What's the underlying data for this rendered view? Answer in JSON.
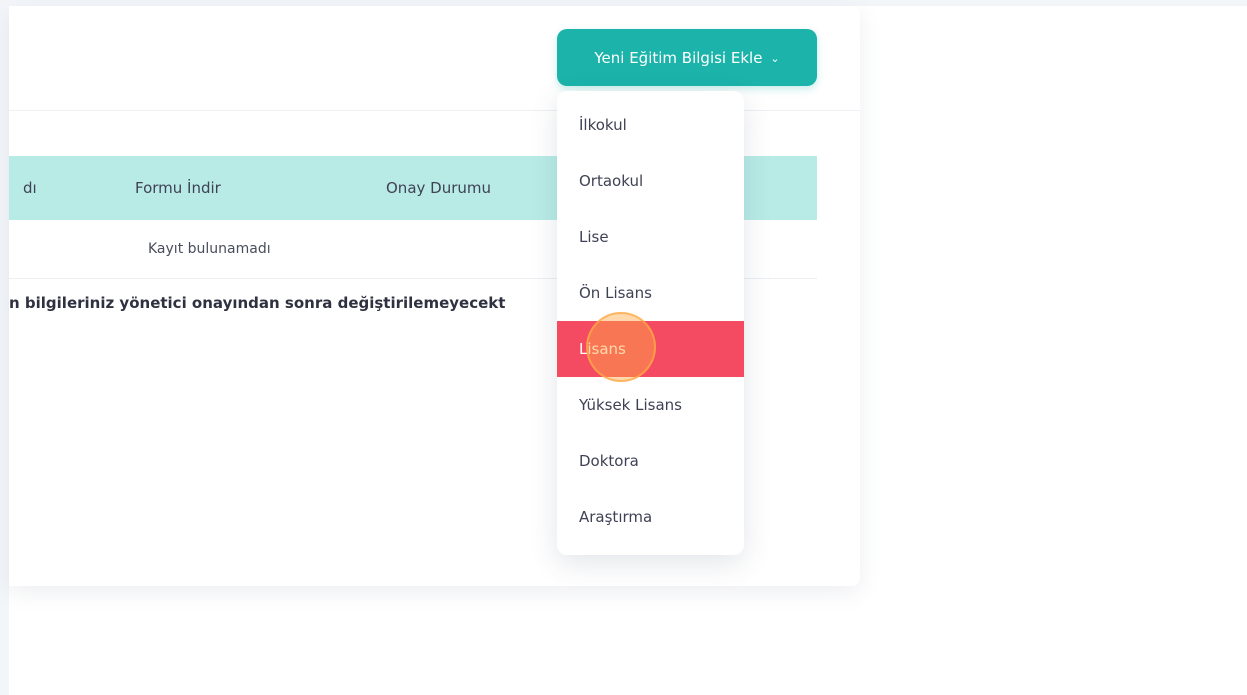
{
  "toolbar": {
    "add_button_label": "Yeni Eğitim Bilgisi Ekle",
    "chevron": "⌄"
  },
  "table": {
    "headers": [
      "dı",
      "Formu İndir",
      "Onay Durumu"
    ],
    "empty_message": "Kayıt bulunamadı"
  },
  "notice": {
    "text": "n bilgileriniz yönetici onayından sonra değiştirilemeyecekt"
  },
  "dropdown": {
    "items": [
      {
        "label": "İlkokul",
        "active": false
      },
      {
        "label": "Ortaokul",
        "active": false
      },
      {
        "label": "Lise",
        "active": false
      },
      {
        "label": "Ön Lisans",
        "active": false
      },
      {
        "label": "Lisans",
        "active": true
      },
      {
        "label": "Yüksek Lisans",
        "active": false
      },
      {
        "label": "Doktora",
        "active": false
      },
      {
        "label": "Araştırma",
        "active": false
      }
    ]
  },
  "colors": {
    "accent": "#1bb3aa",
    "table_header_bg": "#b8ebe6",
    "active_item_bg": "#f44b62",
    "cursor_highlight": "#ffaa46"
  }
}
